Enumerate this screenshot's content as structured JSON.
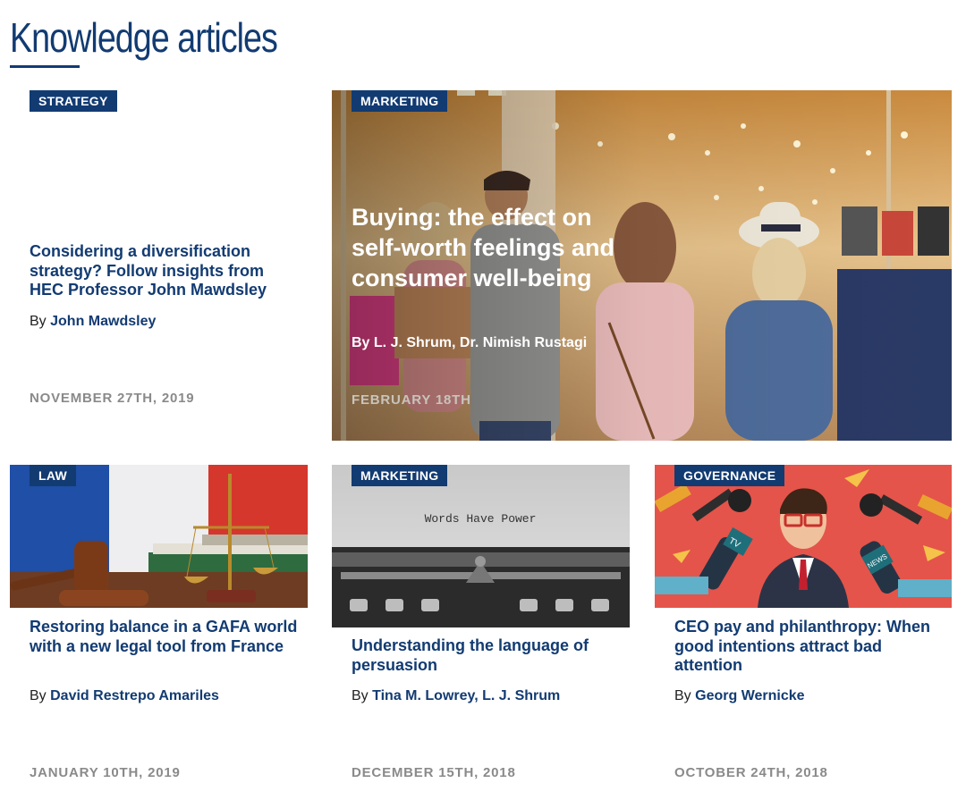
{
  "page": {
    "title": "Knowledge articles"
  },
  "articles": [
    {
      "tag": "STRATEGY",
      "title": "Considering a diversification strategy? Follow insights from HEC Professor John Mawdsley",
      "by_prefix": "By",
      "authors": "John Mawdsley",
      "date": "NOVEMBER 27TH, 2019"
    },
    {
      "tag": "MARKETING",
      "title": "Buying: the effect on self-worth feelings and consumer well-being",
      "by_prefix": "By",
      "authors": "L. J. Shrum, Dr. Nimish Rustagi",
      "date": "FEBRUARY 18TH",
      "image": "shopping-mall-friends-image"
    },
    {
      "tag": "LAW",
      "title": "Restoring balance in a GAFA world with a new legal tool from France",
      "by_prefix": "By",
      "authors": "David Restrepo Amariles",
      "date": "JANUARY 10TH, 2019",
      "image": "gavel-scales-french-flag-image"
    },
    {
      "tag": "MARKETING",
      "title": "Understanding the language of persuasion",
      "by_prefix": "By",
      "authors": "Tina M. Lowrey, L. J. Shrum",
      "date": "DECEMBER 15TH, 2018",
      "image": "typewriter-image",
      "image_text": "Words Have Power"
    },
    {
      "tag": "GOVERNANCE",
      "title": "CEO pay and philanthropy: When good intentions attract bad attention",
      "by_prefix": "By",
      "authors": "Georg Wernicke",
      "date": "OCTOBER 24TH, 2018",
      "image": "ceo-press-microphones-image",
      "mic_labels": [
        "TV",
        "NEWS"
      ]
    }
  ],
  "colors": {
    "navy": "#123b72",
    "date_gray": "#8a8a8a",
    "governance_bg": "#e4544a"
  }
}
